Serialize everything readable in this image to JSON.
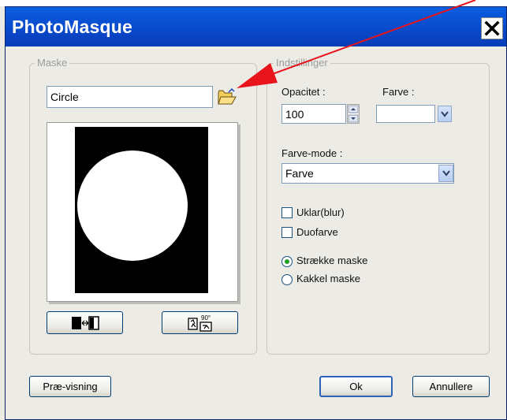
{
  "window": {
    "title": "PhotoMasque"
  },
  "mask_group": {
    "legend": "Maske",
    "mask_name": "Circle"
  },
  "settings_group": {
    "legend": "Indstillinger",
    "opacity_label": "Opacitet :",
    "opacity_value": "100",
    "color_label": "Farve :",
    "color_mode_label": "Farve-mode :",
    "color_mode_value": "Farve",
    "blur_label": "Uklar(blur)",
    "blur_checked": false,
    "duotone_label": "Duofarve",
    "duotone_checked": false,
    "stretch_label": "Strække maske",
    "stretch_selected": true,
    "tile_label": "Kakkel maske",
    "tile_selected": false
  },
  "buttons": {
    "preview": "Præ-visning",
    "ok": "Ok",
    "cancel": "Annullere",
    "rotate_badge": "90°"
  },
  "colors": {
    "title_bar": "#0a4fd1",
    "annotation_arrow": "#e8141c",
    "dialog_bg": "#ecebe5"
  }
}
